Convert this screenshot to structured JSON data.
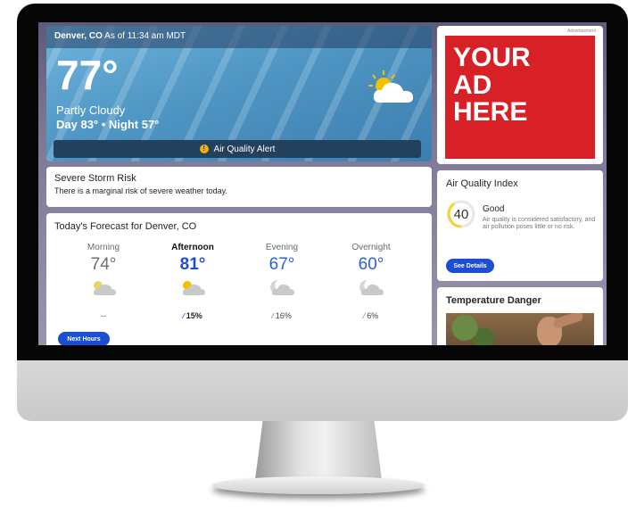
{
  "location": {
    "city": "Denver, CO",
    "as_of": "As of 11:34 am MDT"
  },
  "current": {
    "temperature": "77°",
    "phrase": "Partly Cloudy",
    "day_night": "Day 83° • Night 57°",
    "icon": "partly-cloudy-icon",
    "alert": "Air Quality Alert"
  },
  "storm": {
    "title": "Severe Storm Risk",
    "text": "There is a marginal risk of severe weather today."
  },
  "forecast": {
    "title": "Today's Forecast for Denver, CO",
    "periods": [
      {
        "name": "Morning",
        "temp": "74°",
        "precip": "--",
        "icon": "partly-cloudy-day-icon"
      },
      {
        "name": "Afternoon",
        "temp": "81°",
        "precip": "15%",
        "icon": "partly-cloudy-day-icon"
      },
      {
        "name": "Evening",
        "temp": "67°",
        "precip": "16%",
        "icon": "partly-cloudy-night-icon"
      },
      {
        "name": "Overnight",
        "temp": "60°",
        "precip": "6%",
        "icon": "partly-cloudy-night-icon"
      }
    ],
    "button": "Next Hours"
  },
  "ad": {
    "label": "Advertisement",
    "line1": "YOUR",
    "line2": "AD",
    "line3": "HERE"
  },
  "aqi": {
    "title": "Air Quality Index",
    "value": "40",
    "level": 0.4,
    "category": "Good",
    "description": "Air quality is considered satisfactory, and air pollution poses little or no risk.",
    "button": "See Details"
  },
  "temp_danger": {
    "title": "Temperature Danger"
  },
  "colors": {
    "accent": "#1b4fd2",
    "ad_red": "#d82127",
    "alert_yellow": "#f0b400"
  }
}
